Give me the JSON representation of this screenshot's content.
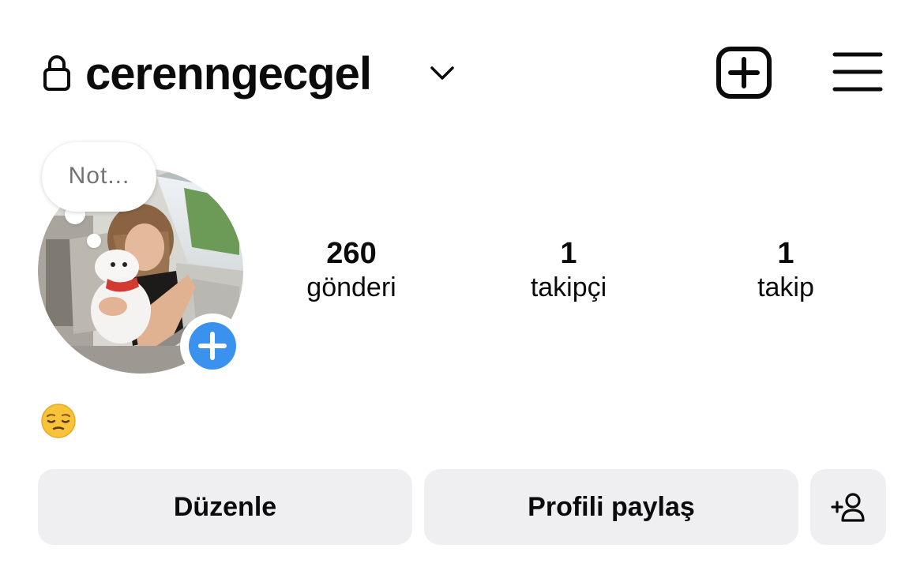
{
  "header": {
    "username": "cerenngecgel",
    "icons": {
      "lock": "lock-icon",
      "switch_account": "chevron-down-icon",
      "new_post": "plus-square-icon",
      "menu": "hamburger-menu-icon"
    }
  },
  "note": {
    "placeholder": "Not..."
  },
  "avatar": {
    "add_story_icon": "plus-icon",
    "add_story_color": "#3b92ee"
  },
  "stats": {
    "posts": {
      "count": "260",
      "label": "gönderi"
    },
    "followers": {
      "count": "1",
      "label": "takipçi"
    },
    "following": {
      "count": "1",
      "label": "takip"
    }
  },
  "bio": {
    "emoji": "pensive-face-emoji"
  },
  "actions": {
    "edit_label": "Düzenle",
    "share_label": "Profili paylaş",
    "discover_icon": "add-person-icon"
  },
  "colors": {
    "text": "#0b0b0b",
    "button_bg": "#efeff2",
    "muted": "#737373",
    "accent": "#3b92ee"
  }
}
